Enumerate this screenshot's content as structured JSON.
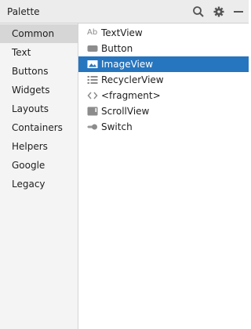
{
  "header": {
    "title": "Palette"
  },
  "icons": {
    "search": "search-icon",
    "settings": "gear-icon",
    "minimize": "minimize-icon"
  },
  "sidebar": {
    "items": [
      {
        "label": "Common",
        "selected": true
      },
      {
        "label": "Text"
      },
      {
        "label": "Buttons"
      },
      {
        "label": "Widgets"
      },
      {
        "label": "Layouts"
      },
      {
        "label": "Containers"
      },
      {
        "label": "Helpers"
      },
      {
        "label": "Google"
      },
      {
        "label": "Legacy"
      }
    ]
  },
  "widgets": {
    "textview_glyph": "Ab",
    "items": [
      {
        "label": "TextView",
        "icon": "textview-icon"
      },
      {
        "label": "Button",
        "icon": "button-icon"
      },
      {
        "label": "ImageView",
        "icon": "imageview-icon",
        "selected": true
      },
      {
        "label": "RecyclerView",
        "icon": "recyclerview-icon"
      },
      {
        "label": "<fragment>",
        "icon": "fragment-icon"
      },
      {
        "label": "ScrollView",
        "icon": "scrollview-icon"
      },
      {
        "label": "Switch",
        "icon": "switch-icon"
      }
    ]
  },
  "colors": {
    "selection": "#2675bf",
    "header_bg": "#ececec",
    "sidebar_bg": "#f4f4f4",
    "sidebar_selected": "#d6d6d6"
  }
}
